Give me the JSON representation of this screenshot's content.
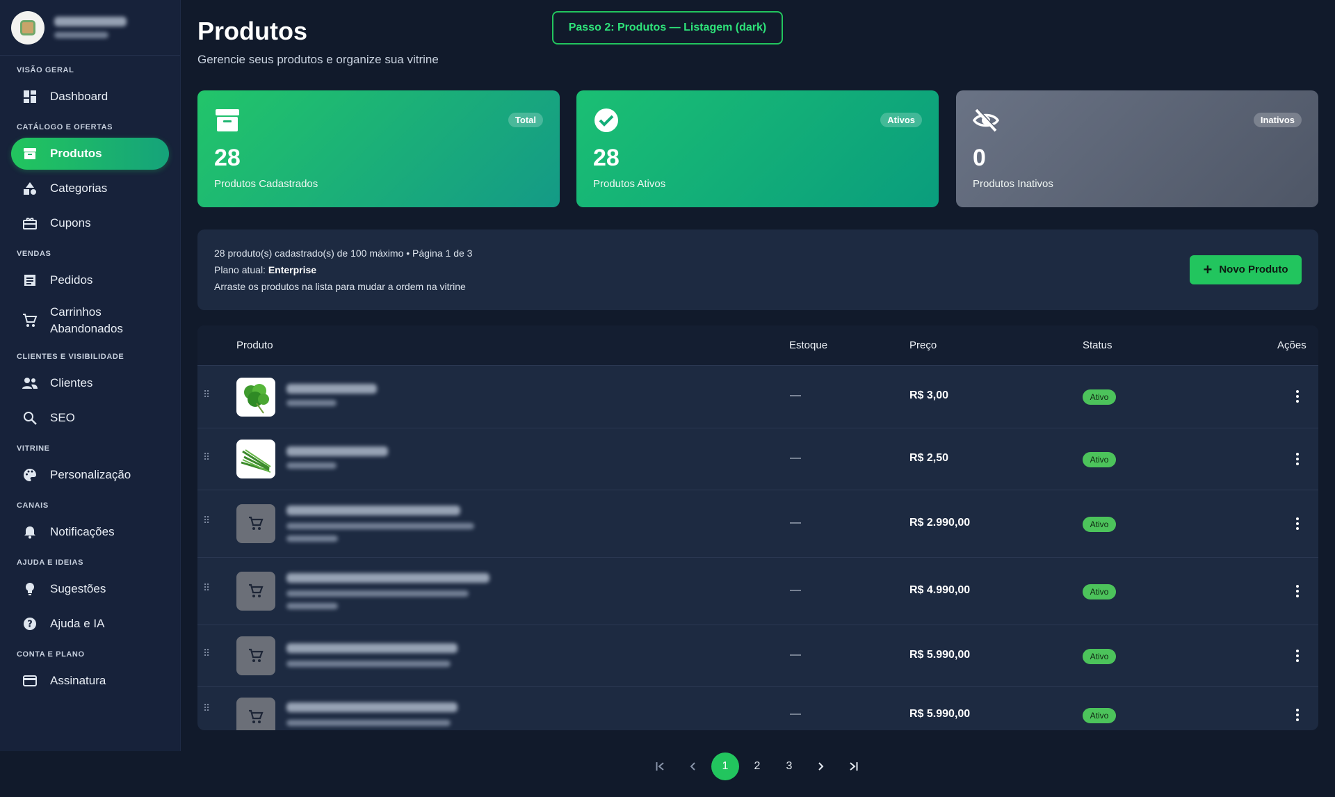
{
  "step_label": "Passo 2: Produtos — Listagem (dark)",
  "sidebar": {
    "sections": [
      {
        "title": "VISÃO GERAL",
        "items": [
          {
            "label": "Dashboard",
            "icon": "dashboard-icon"
          }
        ]
      },
      {
        "title": "CATÁLOGO E OFERTAS",
        "items": [
          {
            "label": "Produtos",
            "icon": "archive-icon",
            "active": true
          },
          {
            "label": "Categorias",
            "icon": "shapes-icon"
          },
          {
            "label": "Cupons",
            "icon": "gift-icon"
          }
        ]
      },
      {
        "title": "VENDAS",
        "items": [
          {
            "label": "Pedidos",
            "icon": "receipt-icon"
          },
          {
            "label": "Carrinhos Abandonados",
            "icon": "cart-icon"
          }
        ]
      },
      {
        "title": "CLIENTES E VISIBILIDADE",
        "items": [
          {
            "label": "Clientes",
            "icon": "people-icon"
          },
          {
            "label": "SEO",
            "icon": "search-icon"
          }
        ]
      },
      {
        "title": "VITRINE",
        "items": [
          {
            "label": "Personalização",
            "icon": "palette-icon"
          }
        ]
      },
      {
        "title": "CANAIS",
        "items": [
          {
            "label": "Notificações",
            "icon": "bell-icon"
          }
        ]
      },
      {
        "title": "AJUDA E IDEIAS",
        "items": [
          {
            "label": "Sugestões",
            "icon": "bulb-icon"
          },
          {
            "label": "Ajuda e IA",
            "icon": "help-icon"
          }
        ]
      },
      {
        "title": "CONTA E PLANO",
        "items": [
          {
            "label": "Assinatura",
            "icon": "card-icon"
          }
        ]
      }
    ]
  },
  "header": {
    "title": "Produtos",
    "subtitle": "Gerencie seus produtos e organize sua vitrine"
  },
  "stats": [
    {
      "badge": "Total",
      "value": "28",
      "caption": "Produtos Cadastrados",
      "icon": "archive-icon"
    },
    {
      "badge": "Ativos",
      "value": "28",
      "caption": "Produtos Ativos",
      "icon": "check-circle-icon"
    },
    {
      "badge": "Inativos",
      "value": "0",
      "caption": "Produtos Inativos",
      "icon": "eye-off-icon"
    }
  ],
  "info": {
    "line1": "28 produto(s) cadastrado(s) de 100 máximo • Página 1 de 3",
    "plan_prefix": "Plano atual: ",
    "plan_name": "Enterprise",
    "line3": "Arraste os produtos na lista para mudar a ordem na vitrine",
    "new_button": "Novo Produto"
  },
  "table": {
    "columns": [
      "Produto",
      "Estoque",
      "Preço",
      "Status",
      "Ações"
    ],
    "rows": [
      {
        "stock": "—",
        "price": "R$ 3,00",
        "status": "Ativo",
        "thumb": "photo-parsley"
      },
      {
        "stock": "—",
        "price": "R$ 2,50",
        "status": "Ativo",
        "thumb": "photo-chives"
      },
      {
        "stock": "—",
        "price": "R$ 2.990,00",
        "status": "Ativo",
        "thumb": "cart-icon"
      },
      {
        "stock": "—",
        "price": "R$ 4.990,00",
        "status": "Ativo",
        "thumb": "cart-icon"
      },
      {
        "stock": "—",
        "price": "R$ 5.990,00",
        "status": "Ativo",
        "thumb": "cart-icon"
      },
      {
        "stock": "—",
        "price": "R$ 5.990,00",
        "status": "Ativo",
        "thumb": "cart-icon"
      }
    ]
  },
  "pagination": {
    "pages": [
      "1",
      "2",
      "3"
    ],
    "current": "1"
  }
}
